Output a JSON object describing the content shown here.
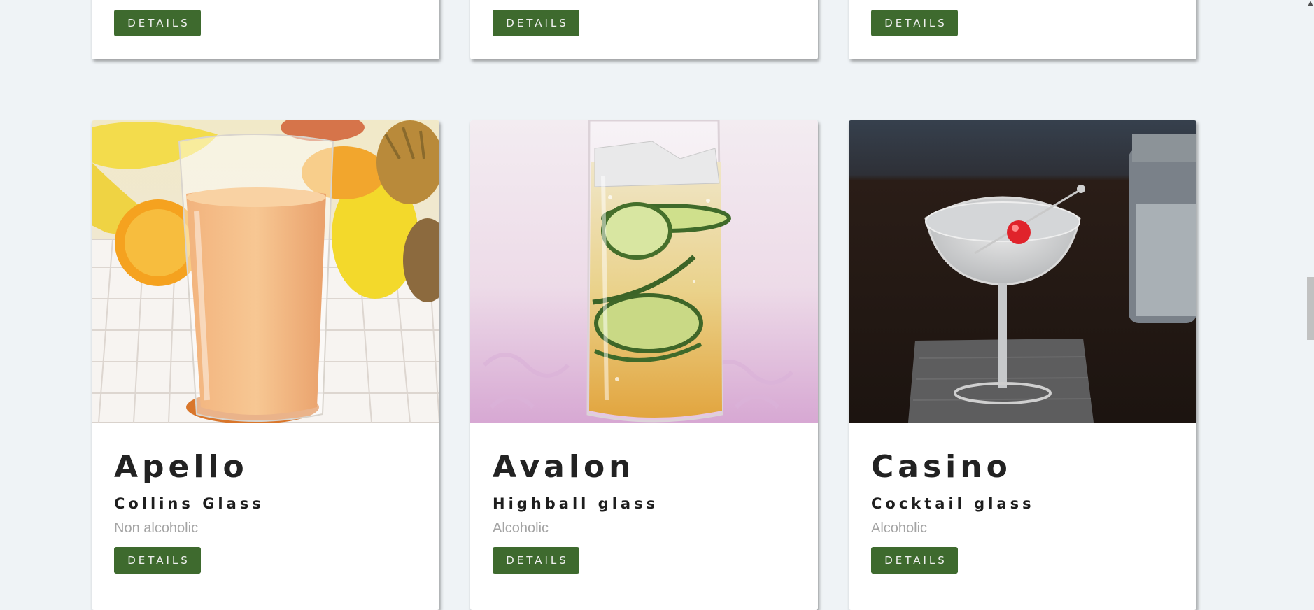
{
  "cards_top": [
    {
      "button_label": "DETAILS"
    },
    {
      "button_label": "DETAILS"
    },
    {
      "button_label": "DETAILS"
    }
  ],
  "cards": [
    {
      "name": "Apello",
      "glass": "Collins Glass",
      "type": "Non alcoholic",
      "button_label": "DETAILS",
      "image": "orange-juice-glass-with-fruit"
    },
    {
      "name": "Avalon",
      "glass": "Highball glass",
      "type": "Alcoholic",
      "button_label": "DETAILS",
      "image": "highball-with-cucumber-slices"
    },
    {
      "name": "Casino",
      "glass": "Cocktail glass",
      "type": "Alcoholic",
      "button_label": "DETAILS",
      "image": "coupe-cocktail-with-cherry"
    }
  ],
  "colors": {
    "page_background": "#eff3f6",
    "button_background": "#3e6a2e",
    "button_text": "#f0f0f0",
    "title_text": "#222222",
    "muted_text": "#a4a4a4"
  },
  "scrollbar": {
    "up_arrow_icon": "chevron-up-icon"
  }
}
